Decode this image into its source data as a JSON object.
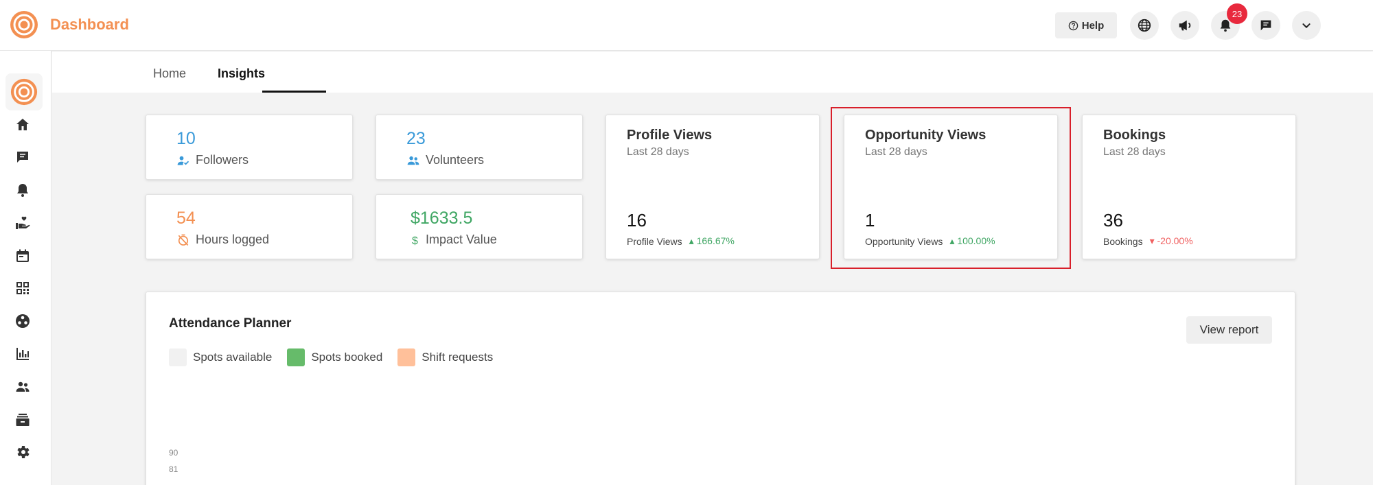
{
  "app": {
    "title": "Dashboard",
    "brand_color": "#f39052"
  },
  "topbar": {
    "help_label": "Help",
    "notification_count": "23",
    "icons": [
      "globe-icon",
      "megaphone-icon",
      "bell-icon",
      "chat-icon",
      "chevron-down-icon"
    ]
  },
  "sidebar": {
    "items": [
      "home-icon",
      "messages-icon",
      "bell-icon",
      "volunteer-hand-icon",
      "calendar-icon",
      "qr-code-icon",
      "groups-icon",
      "bar-chart-icon",
      "people-icon",
      "inventory-icon",
      "settings-icon"
    ]
  },
  "tabs": [
    {
      "label": "Home",
      "active": false
    },
    {
      "label": "Insights",
      "active": true
    }
  ],
  "stats": {
    "followers": {
      "value": "10",
      "label": "Followers",
      "color": "#3a9ad9"
    },
    "volunteers": {
      "value": "23",
      "label": "Volunteers",
      "color": "#3a9ad9"
    },
    "hours": {
      "value": "54",
      "label": "Hours logged",
      "color": "#f39052"
    },
    "impact": {
      "value": "$1633.5",
      "label": "Impact Value",
      "color": "#3fa663"
    }
  },
  "metrics": {
    "profile_views": {
      "title": "Profile Views",
      "subtitle": "Last 28 days",
      "value": "16",
      "footer": "Profile Views",
      "change": "166.67%",
      "direction": "up"
    },
    "opportunity_views": {
      "title": "Opportunity Views",
      "subtitle": "Last 28 days",
      "value": "1",
      "footer": "Opportunity Views",
      "change": "100.00%",
      "direction": "up"
    },
    "bookings": {
      "title": "Bookings",
      "subtitle": "Last 28 days",
      "value": "36",
      "footer": "Bookings",
      "change": "-20.00%",
      "direction": "down"
    }
  },
  "planner": {
    "title": "Attendance Planner",
    "view_report_label": "View report",
    "legend": [
      {
        "label": "Spots available",
        "color": "#f1f1f1"
      },
      {
        "label": "Spots booked",
        "color": "#66bb6a"
      },
      {
        "label": "Shift requests",
        "color": "#ffc09a"
      }
    ],
    "y_ticks": [
      "90",
      "81"
    ]
  }
}
